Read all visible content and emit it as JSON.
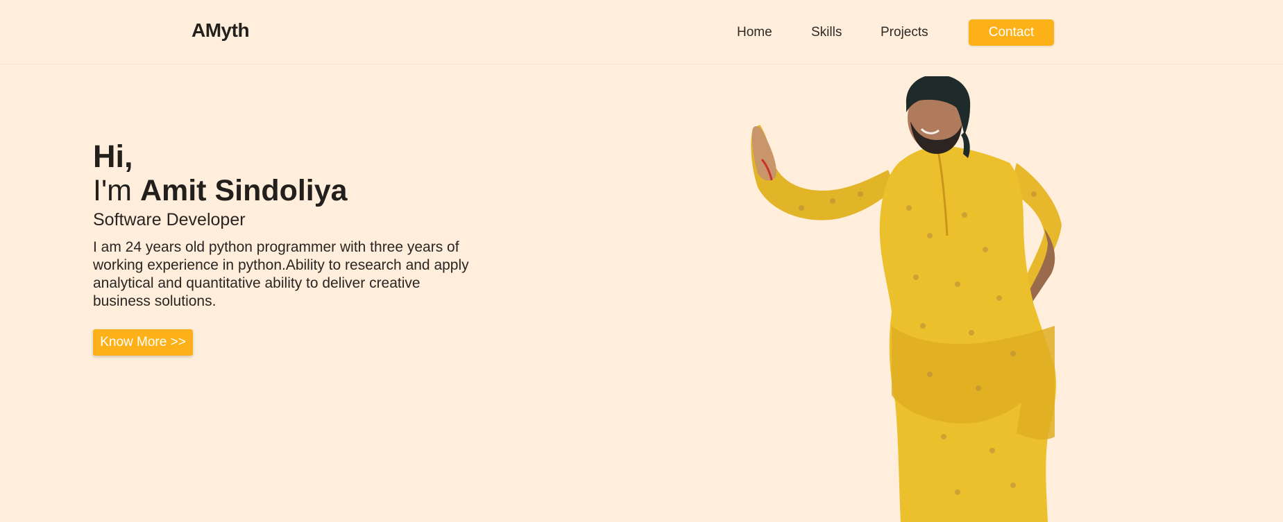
{
  "header": {
    "brand": "AMyth",
    "nav": {
      "home": "Home",
      "skills": "Skills",
      "projects": "Projects",
      "contact": "Contact"
    }
  },
  "hero": {
    "greeting": "Hi,",
    "intro_prefix": "I'm",
    "name": "Amit Sindoliya",
    "role": "Software Developer",
    "bio": "I am 24 years old python programmer with three years of working experience in python.Ability to research and apply analytical and quantitative ability to deliver creative business solutions.",
    "cta": "Know More >>"
  },
  "colors": {
    "background": "#feeedb",
    "accent": "#fcb118",
    "text": "#231f1c"
  },
  "icons": {
    "portrait": "person-portrait-illustration"
  }
}
